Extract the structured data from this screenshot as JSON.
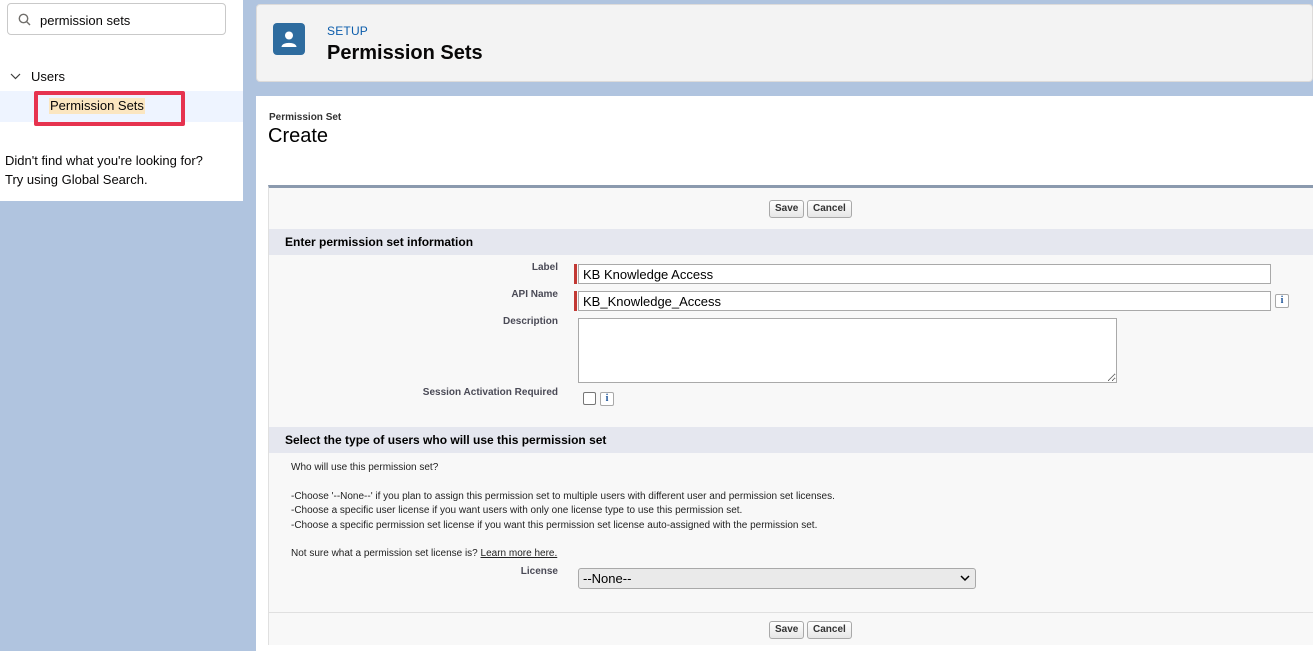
{
  "sidebar": {
    "search_value": "permission sets",
    "tree_parent": "Users",
    "tree_child": "Permission Sets",
    "not_found_line1": "Didn't find what you're looking for?",
    "not_found_line2": "Try using Global Search."
  },
  "header": {
    "setup": "SETUP",
    "title": "Permission Sets"
  },
  "page": {
    "object_label": "Permission Set",
    "title": "Create"
  },
  "buttons": {
    "save": "Save",
    "cancel": "Cancel"
  },
  "section1": {
    "title": "Enter permission set information",
    "label_label": "Label",
    "label_value": "KB Knowledge Access",
    "api_name_label": "API Name",
    "api_name_value": "KB_Knowledge_Access",
    "description_label": "Description",
    "session_label": "Session Activation Required",
    "info_glyph": "i"
  },
  "section2": {
    "title": "Select the type of users who will use this permission set",
    "question": "Who will use this permission set?",
    "help1": "-Choose '--None--' if you plan to assign this permission set to multiple users with different user and permission set licenses.",
    "help2": "-Choose a specific user license if you want users with only one license type to use this permission set.",
    "help3": "-Choose a specific permission set license if you want this permission set license auto-assigned with the permission set.",
    "not_sure": "Not sure what a permission set license is?",
    "learn_more": "Learn more here.",
    "license_label": "License",
    "license_value": "--None--"
  }
}
